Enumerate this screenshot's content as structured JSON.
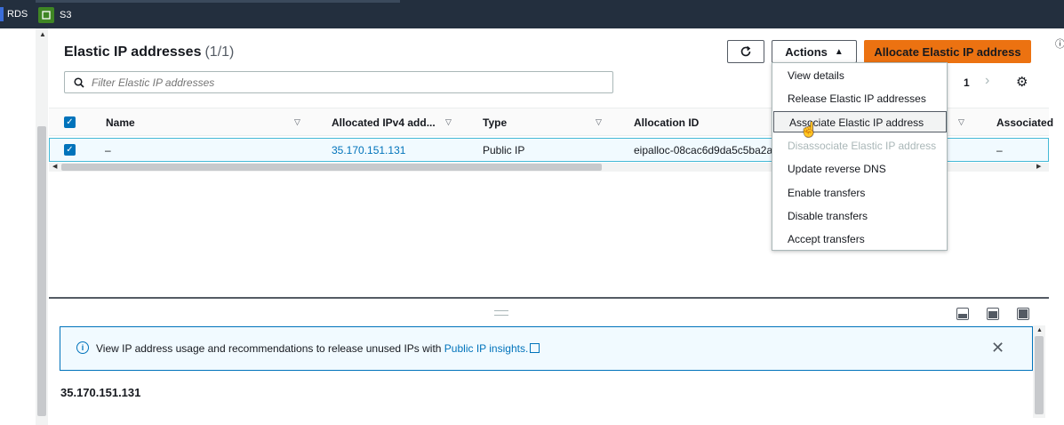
{
  "nav": {
    "services": [
      {
        "label": "RDS"
      },
      {
        "label": "S3"
      }
    ]
  },
  "header": {
    "title": "Elastic IP addresses",
    "count": "(1/1)",
    "actions_label": "Actions",
    "allocate_label": "Allocate Elastic IP address"
  },
  "filter": {
    "placeholder": "Filter Elastic IP addresses"
  },
  "pagination": {
    "page": "1"
  },
  "table": {
    "columns": [
      "Name",
      "Allocated IPv4 add...",
      "Type",
      "Allocation ID",
      "Associated"
    ],
    "rows": [
      {
        "name": "–",
        "ip": "35.170.151.131",
        "type": "Public IP",
        "allocation_id": "eipalloc-08cac6d9da5c5ba2a",
        "associated": "–"
      }
    ]
  },
  "actions_menu": {
    "items": [
      {
        "label": "View details",
        "state": "normal"
      },
      {
        "label": "Release Elastic IP addresses",
        "state": "normal"
      },
      {
        "label": "Associate Elastic IP address",
        "state": "hover"
      },
      {
        "label": "Disassociate Elastic IP address",
        "state": "disabled"
      },
      {
        "label": "Update reverse DNS",
        "state": "normal"
      },
      {
        "label": "Enable transfers",
        "state": "normal"
      },
      {
        "label": "Disable transfers",
        "state": "normal"
      },
      {
        "label": "Accept transfers",
        "state": "normal"
      }
    ]
  },
  "info_banner": {
    "text": "View IP address usage and recommendations to release unused IPs with",
    "link": "Public IP insights."
  },
  "detail": {
    "title": "35.170.151.131"
  },
  "colors": {
    "primary": "#ec7211",
    "link": "#0073bb",
    "topbar": "#232f3e"
  }
}
